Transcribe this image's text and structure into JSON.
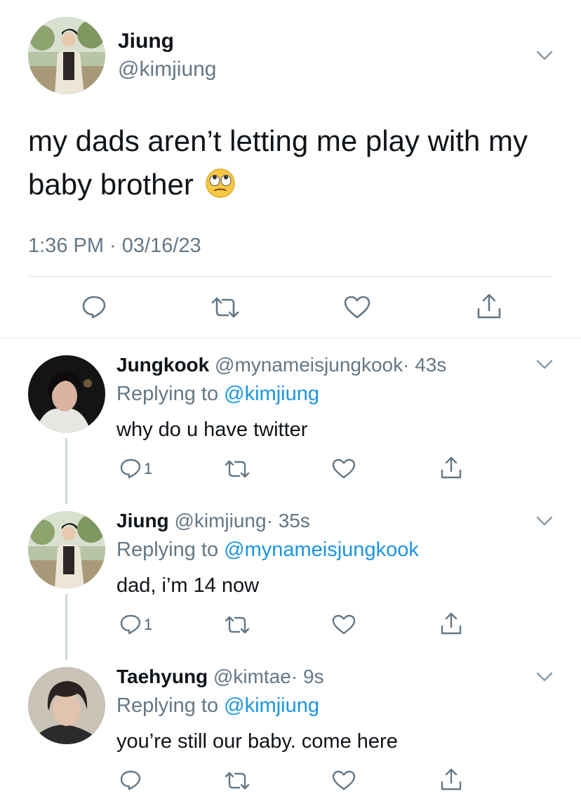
{
  "main_tweet": {
    "author_name": "Jiung",
    "author_handle": "@kimjiung",
    "text": "my dads aren’t letting me play with my baby brother",
    "emoji": "🙄",
    "timestamp": "1:36 PM · 03/16/23"
  },
  "replies": [
    {
      "author_name": "Jungkook",
      "author_handle": "@mynameisjungkook",
      "time": "· 43s",
      "replying_label": "Replying to",
      "replying_to": "@kimjiung",
      "text": "why do u have twitter",
      "reply_count": "1"
    },
    {
      "author_name": "Jiung",
      "author_handle": "@kimjiung",
      "time": "· 35s",
      "replying_label": "Replying to",
      "replying_to": "@mynameisjungkook",
      "text": "dad, i’m 14 now",
      "reply_count": "1"
    },
    {
      "author_name": "Taehyung",
      "author_handle": "@kimtae",
      "time": "· 9s",
      "replying_label": "Replying to",
      "replying_to": "@kimjiung",
      "text": "you’re still our baby. come here",
      "reply_count": ""
    }
  ],
  "icons": {
    "reply": "reply-icon",
    "retweet": "retweet-icon",
    "like": "heart-icon",
    "share": "share-icon",
    "more": "chevron-down-icon"
  },
  "colors": {
    "text": "#0f1419",
    "secondary": "#657786",
    "link": "#1b95e0",
    "divider": "#dfe3e6"
  }
}
